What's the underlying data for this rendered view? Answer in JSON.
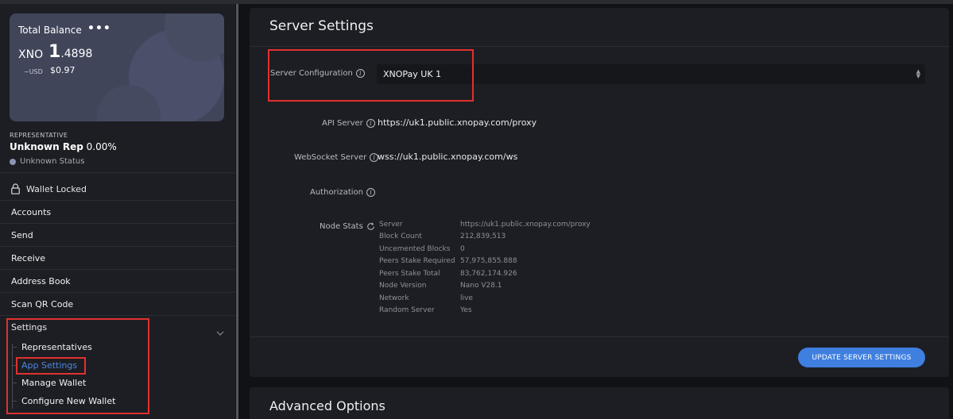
{
  "sidebar": {
    "balance": {
      "title": "Total Balance",
      "menu_dots": "•••",
      "currency": "XNO",
      "amount_int": "1",
      "amount_frac": ".4898",
      "usd_label": "~USD",
      "usd_value": "$0.97"
    },
    "representative": {
      "label": "REPRESENTATIVE",
      "name": "Unknown Rep",
      "weight": "0.00%",
      "status": "Unknown Status"
    },
    "wallet_locked": "Wallet Locked",
    "nav": [
      {
        "label": "Accounts"
      },
      {
        "label": "Send"
      },
      {
        "label": "Receive"
      },
      {
        "label": "Address Book"
      },
      {
        "label": "Scan QR Code"
      },
      {
        "label": "Settings"
      }
    ],
    "settings_sub": [
      {
        "label": "Representatives"
      },
      {
        "label": "App Settings"
      },
      {
        "label": "Manage Wallet"
      },
      {
        "label": "Configure New Wallet"
      }
    ]
  },
  "server_settings": {
    "title": "Server Settings",
    "server_configuration_label": "Server Configuration",
    "server_configuration_value": "XNOPay UK 1",
    "api_server_label": "API Server",
    "api_server_value": "https://uk1.public.xnopay.com/proxy",
    "websocket_label": "WebSocket Server",
    "websocket_value": "wss://uk1.public.xnopay.com/ws",
    "authorization_label": "Authorization",
    "node_stats_label": "Node Stats",
    "node_stats": [
      {
        "key": "Server",
        "value": "https://uk1.public.xnopay.com/proxy"
      },
      {
        "key": "Block Count",
        "value": "212,839,513"
      },
      {
        "key": "Uncemented Blocks",
        "value": "0"
      },
      {
        "key": "Peers Stake Required",
        "value": "57,975,855.888"
      },
      {
        "key": "Peers Stake Total",
        "value": "83,762,174.926"
      },
      {
        "key": "Node Version",
        "value": "Nano V28.1"
      },
      {
        "key": "Network",
        "value": "live"
      },
      {
        "key": "Random Server",
        "value": "Yes"
      }
    ],
    "update_button": "UPDATE SERVER SETTINGS"
  },
  "advanced_options": {
    "title": "Advanced Options"
  },
  "colors": {
    "accent": "#3f7fe0",
    "highlight_box": "#e0312f",
    "card": "#40455a"
  }
}
